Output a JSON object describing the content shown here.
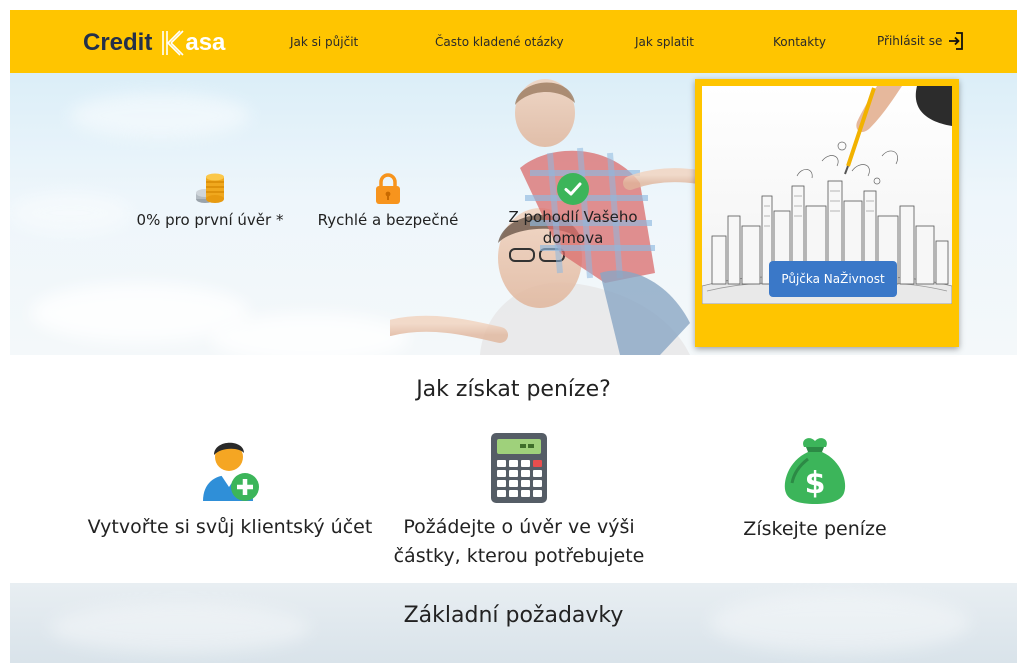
{
  "nav": {
    "logo_word": "Credit",
    "logo_rest": "asa",
    "items": [
      {
        "label": "Jak si půjčit"
      },
      {
        "label": "Často kladené otázky"
      },
      {
        "label": "Jak splatit"
      },
      {
        "label": "Kontakty"
      }
    ],
    "login_label": "Přihlásit se"
  },
  "hero": {
    "features": [
      {
        "label": "0% pro první úvěr *",
        "icon": "coins-icon"
      },
      {
        "label": "Rychlé a bezpečné",
        "icon": "lock-icon"
      },
      {
        "label": "Z pohodlí Vašeho domova",
        "icon": "check-icon"
      }
    ],
    "card_button": "Půjčka NaŽivnost"
  },
  "how": {
    "title": "Jak získat peníze?",
    "steps": [
      {
        "label": "Vytvořte si svůj klientský účet",
        "icon": "add-user-icon"
      },
      {
        "label": "Požádejte o úvěr ve výši částky, kterou potřebujete",
        "icon": "calculator-icon"
      },
      {
        "label": "Získejte peníze",
        "icon": "money-bag-icon"
      }
    ]
  },
  "requirements": {
    "title": "Základní požadavky"
  },
  "colors": {
    "brand_yellow": "#ffc500",
    "navy": "#23304a",
    "button_blue": "#3a78c8",
    "check_green": "#3cb55a",
    "lock_orange": "#f7941d"
  }
}
